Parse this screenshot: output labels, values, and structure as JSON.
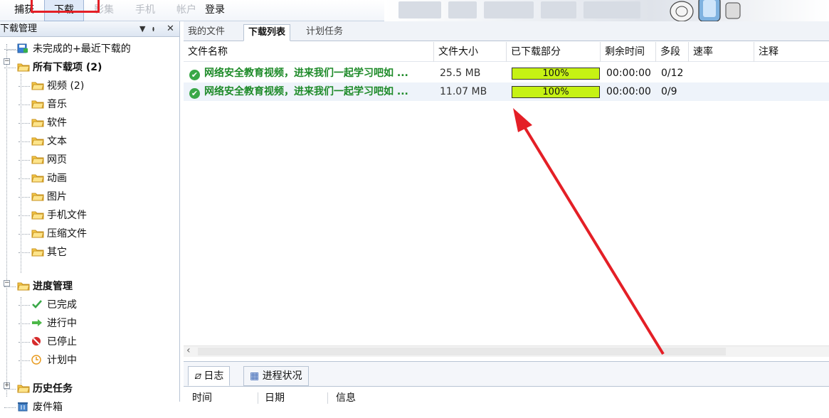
{
  "menu": {
    "capture": "捕获",
    "download": "下载",
    "collection": "影集",
    "phone": "手机",
    "account": "帐户",
    "login": "登录"
  },
  "left_panel": {
    "title": "下载管理",
    "pin_glyph": "▾ ⊓ ✕",
    "tree": {
      "incomplete_recent": "未完成的+最近下载的",
      "all_downloads": "所有下载项 (2)",
      "categories": [
        "视频 (2)",
        "音乐",
        "软件",
        "文本",
        "网页",
        "动画",
        "图片",
        "手机文件",
        "压缩文件",
        "其它"
      ],
      "progress_management": "进度管理",
      "progress_items": [
        "已完成",
        "进行中",
        "已停止",
        "计划中"
      ],
      "history": "历史任务",
      "trash": "废件箱"
    }
  },
  "tabs": [
    "我的文件",
    "下载列表",
    "计划任务"
  ],
  "active_tab_index": 1,
  "table": {
    "columns": [
      "文件名称",
      "文件大小",
      "已下载部分",
      "剩余时间",
      "多段",
      "速率",
      "注释"
    ],
    "rows": [
      {
        "name": "网络安全教育视频，进来我们一起学习吧如 ...",
        "size": "25.5 MB",
        "progress": 100,
        "progress_label": "100%",
        "remaining": "00:00:00",
        "segments": "0/12"
      },
      {
        "name": "网络安全教育视频，进来我们一起学习吧如 ...",
        "size": "11.07 MB",
        "progress": 100,
        "progress_label": "100%",
        "remaining": "00:00:00",
        "segments": "0/9"
      }
    ]
  },
  "bottom_panel": {
    "tabs": [
      "日志",
      "进程状况"
    ],
    "log_columns": [
      "时间",
      "日期",
      "信息"
    ]
  },
  "colors": {
    "progress_fill": "#c6f214",
    "file_name": "#1d8a28",
    "annotation": "#e41f26"
  }
}
